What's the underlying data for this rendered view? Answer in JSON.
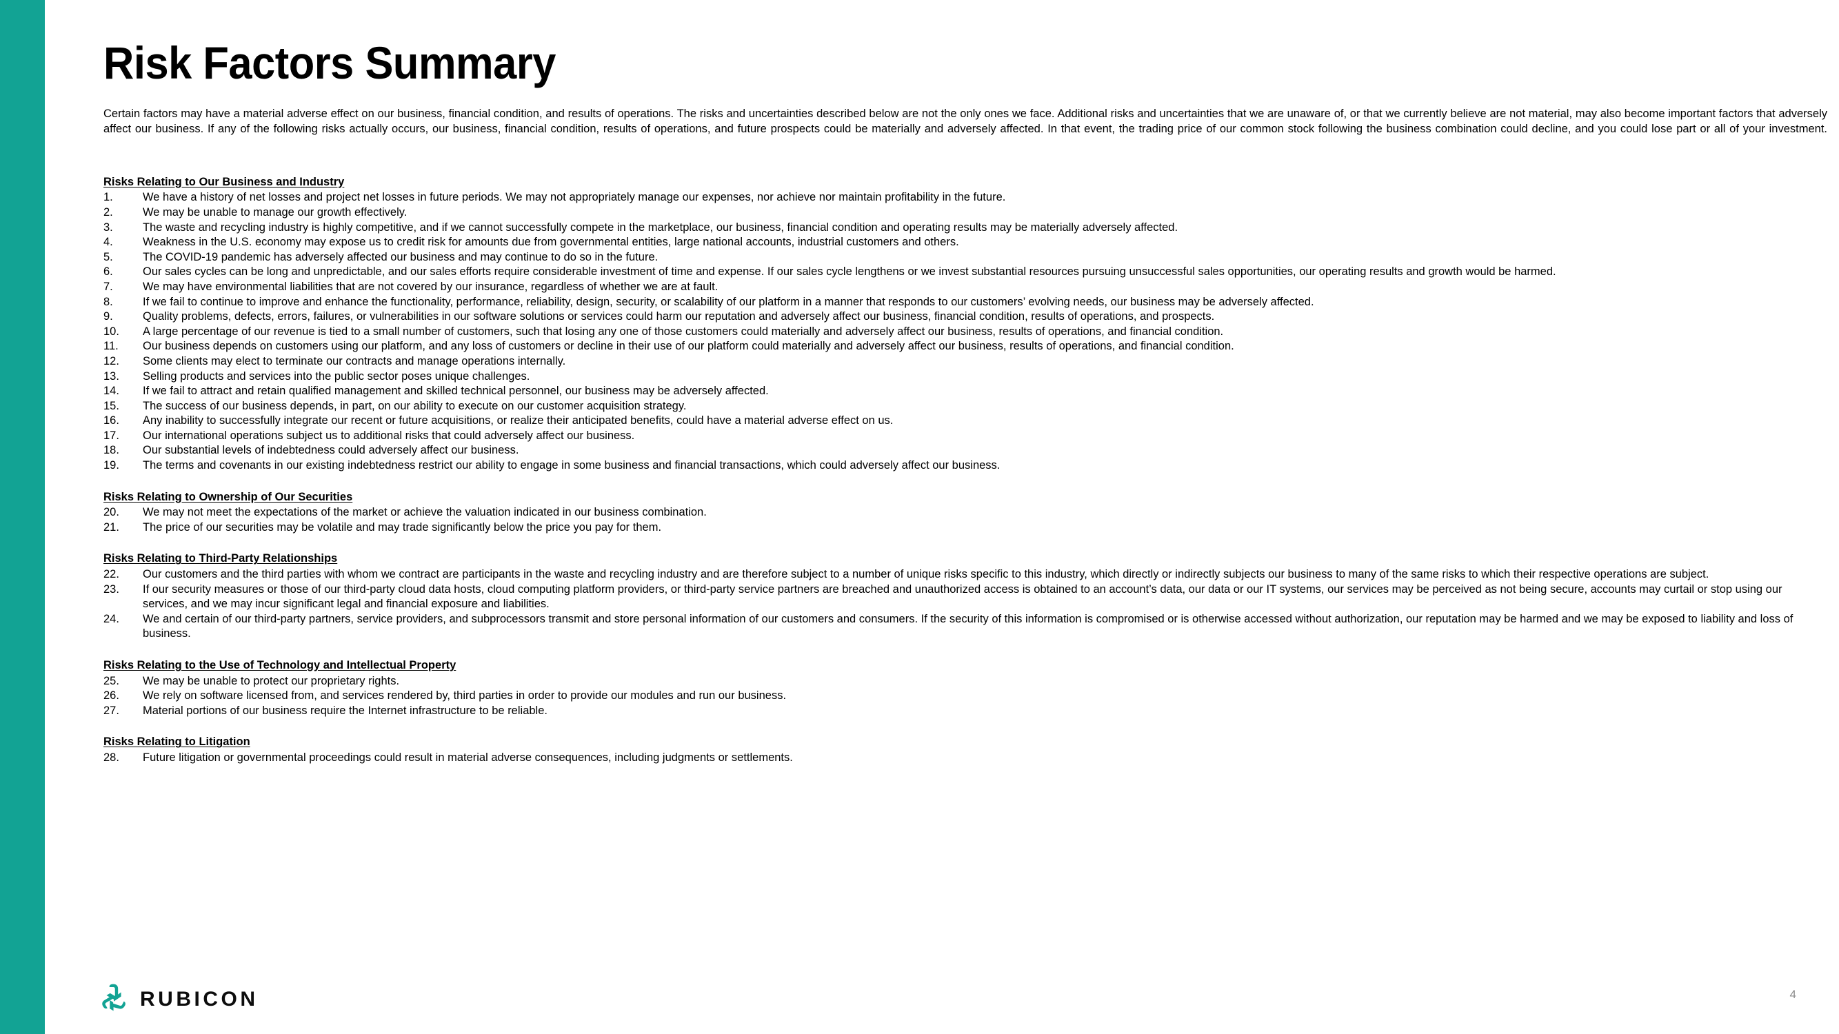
{
  "theme": {
    "accent_color": "#12a394",
    "text_color": "#000000",
    "page_number_color": "#8c8c8c"
  },
  "page_title": "Risk Factors Summary",
  "intro": "Certain factors may have a material adverse effect on our business, financial condition, and results of operations. The risks and uncertainties described below are not the only ones we face. Additional risks and uncertainties that we are unaware of, or that we currently believe are not material, may also become important factors that adversely affect our business. If any of the following risks actually occurs, our business, financial condition, results of operations, and future prospects could be materially and adversely affected. In that event, the trading price of our common stock following the business combination could decline, and you could lose part or all of your investment.",
  "sections": [
    {
      "heading": "Risks Relating to Our Business and Industry",
      "items": [
        {
          "number": "1.",
          "text": "We have a history of net losses and project net losses in future periods.  We may not appropriately manage our expenses, nor achieve nor maintain profitability in the future."
        },
        {
          "number": "2.",
          "text": "We may be unable to manage our growth effectively."
        },
        {
          "number": "3.",
          "text": "The waste and recycling industry is highly competitive, and if we cannot successfully compete in the marketplace, our business, financial condition and operating results may be materially adversely affected."
        },
        {
          "number": "4.",
          "text": "Weakness in the U.S. economy may expose us to credit risk for amounts due from governmental entities, large national accounts, industrial customers and others."
        },
        {
          "number": "5.",
          "text": "The COVID-19 pandemic has adversely affected our business and may continue to do so in the future."
        },
        {
          "number": "6.",
          "text": "Our sales cycles can be long and unpredictable, and our sales efforts require considerable investment of time and expense. If our sales cycle lengthens or we invest substantial resources pursuing unsuccessful sales opportunities, our operating results and growth would be harmed."
        },
        {
          "number": "7.",
          "text": "We may have environmental liabilities that are not covered by our insurance, regardless of whether we are at fault."
        },
        {
          "number": "8.",
          "text": "If we fail to continue to improve and enhance the functionality, performance, reliability, design, security, or scalability of our platform in a manner that responds to our customers’ evolving needs, our business may be adversely affected."
        },
        {
          "number": "9.",
          "text": "Quality problems, defects, errors, failures, or vulnerabilities in our software solutions or services could harm our reputation and adversely affect our business, financial condition, results of operations, and prospects."
        },
        {
          "number": "10.",
          "text": "A large percentage of our revenue is tied to a small number of customers, such that losing any one of those customers could materially and adversely affect our business, results of operations, and financial condition."
        },
        {
          "number": "11.",
          "text": "Our business depends on customers using our platform, and any loss of customers or decline in their use of our platform could materially and adversely affect our business, results of operations, and financial condition."
        },
        {
          "number": "12.",
          "text": "Some clients may elect to terminate our contracts and manage operations internally."
        },
        {
          "number": "13.",
          "text": "Selling products and services into the public sector poses unique challenges."
        },
        {
          "number": "14.",
          "text": "If we fail to attract and retain qualified management and skilled technical personnel, our business may be adversely affected."
        },
        {
          "number": "15.",
          "text": "The success of our business depends, in part, on our ability to execute on our customer acquisition strategy."
        },
        {
          "number": "16.",
          "text": "Any inability to successfully integrate our recent or future acquisitions, or realize their anticipated benefits, could have a material adverse effect on us."
        },
        {
          "number": "17.",
          "text": "Our international operations subject us to additional risks that could adversely affect our business."
        },
        {
          "number": "18.",
          "text": "Our substantial levels of indebtedness could adversely affect our business."
        },
        {
          "number": "19.",
          "text": "The terms and covenants in our existing indebtedness restrict our ability to engage in some business and financial transactions, which could adversely affect our business."
        }
      ]
    },
    {
      "heading": "Risks Relating to Ownership of Our Securities",
      "items": [
        {
          "number": "20.",
          "text": "We may not meet the expectations of the market or achieve the valuation indicated in our business combination."
        },
        {
          "number": "21.",
          "text": "The price of our securities may be volatile and may trade significantly below the price you pay for them."
        }
      ]
    },
    {
      "heading": "Risks Relating to Third-Party Relationships",
      "items": [
        {
          "number": "22.",
          "text": "Our customers and the third parties with whom we contract are participants in the waste and recycling industry and are therefore subject to a number of unique risks specific to this industry, which directly or indirectly subjects our business to many of the same risks to which their respective operations are subject."
        },
        {
          "number": "23.",
          "text": "If our security measures or those of our third-party cloud data hosts, cloud computing platform providers, or third-party service partners are breached and unauthorized access is obtained to an account’s data, our data or our IT systems, our services may be perceived as not being secure, accounts may curtail or stop using our services, and we may incur significant legal and financial exposure and liabilities."
        },
        {
          "number": "24.",
          "text": "We and certain of our third-party partners, service providers, and subprocessors transmit and store personal information of our customers and consumers. If the security of this information is compromised or is otherwise accessed without authorization, our reputation may be harmed and we may be exposed to liability and loss of business."
        }
      ]
    },
    {
      "heading": "Risks Relating to the Use of Technology and Intellectual Property",
      "items": [
        {
          "number": "25.",
          "text": "We may be unable to protect our proprietary rights."
        },
        {
          "number": "26.",
          "text": "We rely on software licensed from, and services rendered by, third parties in order to provide our modules and run our business."
        },
        {
          "number": "27.",
          "text": "Material portions of our business require the Internet infrastructure to be reliable."
        }
      ]
    },
    {
      "heading": "Risks Relating to Litigation",
      "items": [
        {
          "number": "28.",
          "text": "Future litigation or governmental proceedings could result in material adverse consequences, including judgments or settlements."
        }
      ]
    }
  ],
  "footer": {
    "logo_mark": "rubicon-recycle-logo-icon",
    "logo_wordmark": "RUBICON",
    "page_number": "4"
  }
}
